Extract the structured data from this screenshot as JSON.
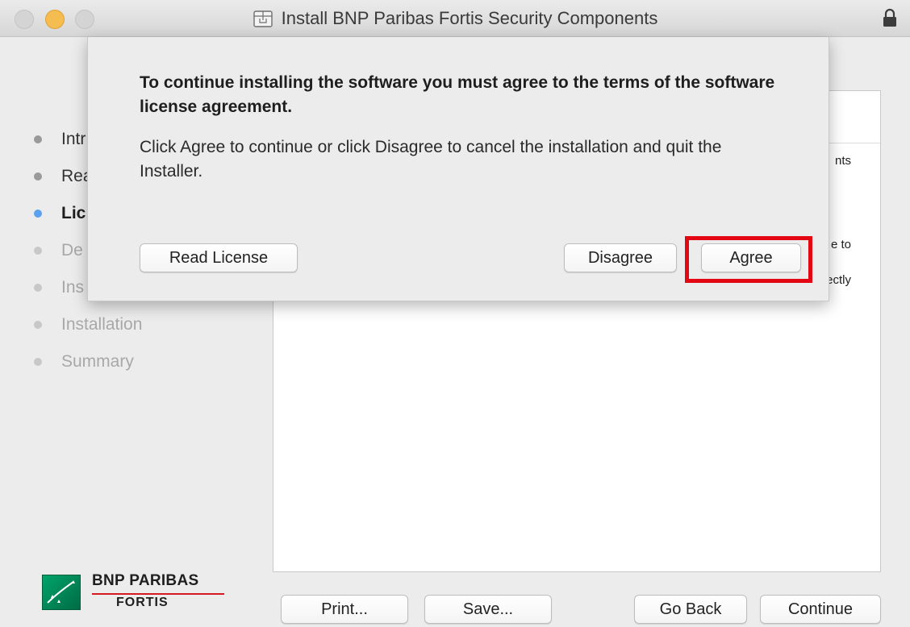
{
  "window": {
    "title": "Install BNP Paribas Fortis Security Components",
    "title_icon": "installer-package-icon",
    "lock_icon": "lock-icon"
  },
  "sidebar": {
    "steps": [
      {
        "label": "Intr",
        "state": "done"
      },
      {
        "label": "Rea",
        "state": "done"
      },
      {
        "label": "Lic",
        "state": "current"
      },
      {
        "label": "De",
        "state": "pending"
      },
      {
        "label": "Ins",
        "state": "pending"
      },
      {
        "label": "Installation",
        "state": "pending"
      },
      {
        "label": "Summary",
        "state": "pending"
      }
    ]
  },
  "content": {
    "fragments": [
      "nts",
      "e to",
      "ectly"
    ]
  },
  "logo": {
    "line1": "BNP PARIBAS",
    "line2": "FORTIS"
  },
  "footer": {
    "print_label": "Print...",
    "save_label": "Save...",
    "go_back_label": "Go Back",
    "continue_label": "Continue"
  },
  "sheet": {
    "heading": "To continue installing the software you must agree to the terms of the software license agreement.",
    "body": "Click Agree to continue or click Disagree to cancel the installation and quit the Installer.",
    "read_license_label": "Read License",
    "disagree_label": "Disagree",
    "agree_label": "Agree"
  },
  "colors": {
    "highlight": "#e30613",
    "current_step_dot": "#5aa2ef",
    "minimize_button": "#f5bd4f",
    "brand_green": "#00a46b",
    "brand_red_rule": "#d71920"
  }
}
